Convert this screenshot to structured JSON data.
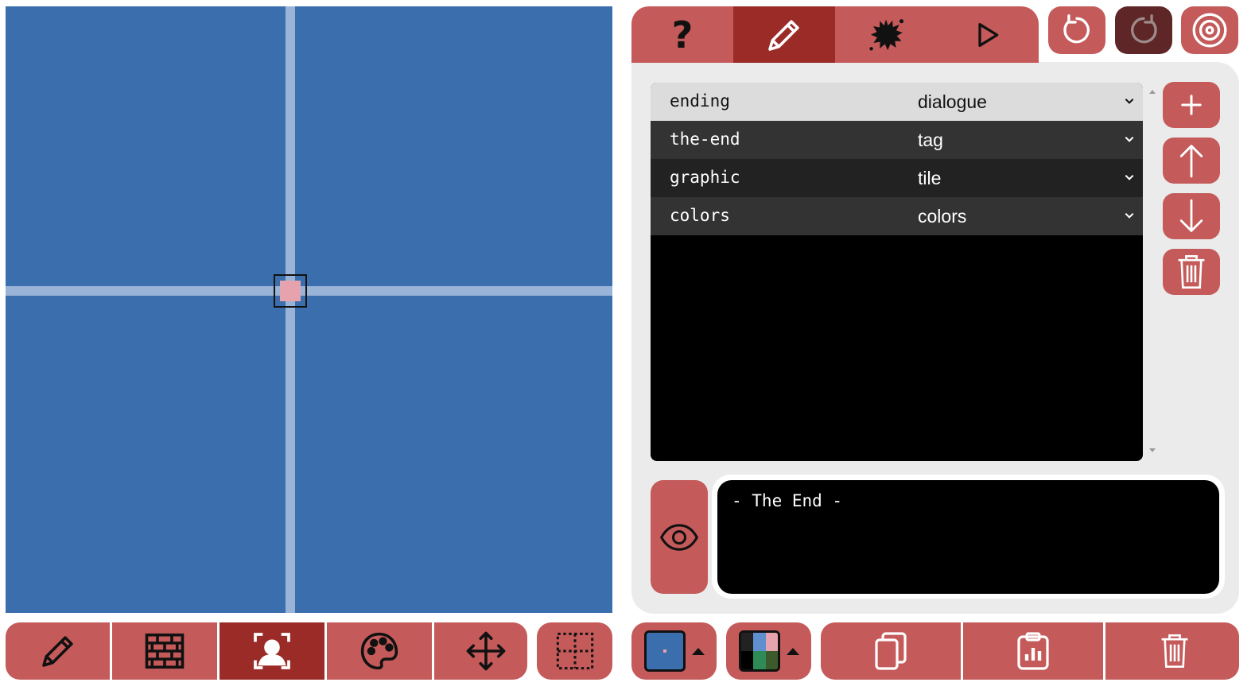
{
  "top_tabs": [
    {
      "name": "help",
      "label": "?",
      "icon": "question-mark",
      "active": false
    },
    {
      "name": "edit",
      "icon": "pencil-icon",
      "active": true
    },
    {
      "name": "effects",
      "icon": "splat-icon",
      "active": false
    },
    {
      "name": "play",
      "icon": "play-icon",
      "active": false
    }
  ],
  "top_actions": [
    {
      "name": "undo",
      "icon": "undo-icon",
      "enabled": true
    },
    {
      "name": "redo",
      "icon": "redo-icon",
      "enabled": false
    },
    {
      "name": "settings",
      "icon": "target-icon",
      "enabled": true
    }
  ],
  "properties": {
    "rows": [
      {
        "key": "ending",
        "type": "dialogue",
        "selected": true
      },
      {
        "key": "the-end",
        "type": "tag",
        "selected": false
      },
      {
        "key": "graphic",
        "type": "tile",
        "selected": false
      },
      {
        "key": "colors",
        "type": "colors",
        "selected": false
      }
    ]
  },
  "side_actions": [
    "add-icon",
    "arrow-up-icon",
    "arrow-down-icon",
    "trash-icon"
  ],
  "dialogue": {
    "text": "- The End -"
  },
  "bottom_tools": [
    {
      "name": "draw",
      "icon": "pencil-icon",
      "active": false
    },
    {
      "name": "walls",
      "icon": "brick-wall-icon",
      "active": false
    },
    {
      "name": "actors",
      "icon": "user-focus-icon",
      "active": true
    },
    {
      "name": "palette",
      "icon": "palette-icon",
      "active": false
    },
    {
      "name": "move",
      "icon": "move-arrows-icon",
      "active": false
    }
  ],
  "grid_toggle": {
    "icon": "grid-icon"
  },
  "clipboard_tools": [
    "copy-icon",
    "paste-icon",
    "trash-icon"
  ],
  "colors": {
    "accent": "#c45a5a",
    "accent_active": "#9a2b27",
    "canvas_bg": "#3b6ead",
    "grid_line": "#9ab4d8",
    "actor_pink": "#e7a3ad",
    "palette": [
      "#000000",
      "#3b6ead",
      "#e7a3ad",
      "#2e7d32",
      "#5f8fcf",
      "#ffffff"
    ]
  }
}
